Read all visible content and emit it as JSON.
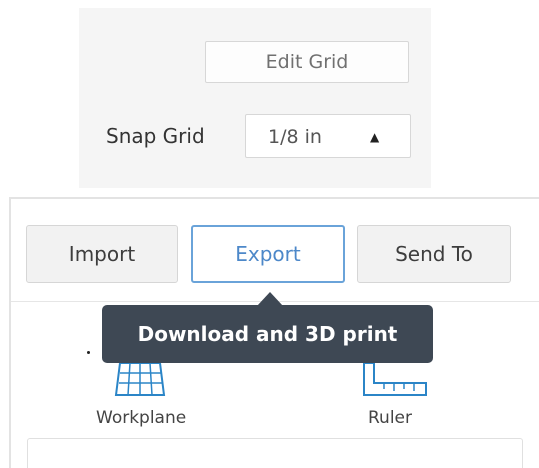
{
  "grid": {
    "edit_label": "Edit Grid",
    "snap_label": "Snap Grid",
    "snap_value": "1/8 in"
  },
  "toolbar": {
    "import_label": "Import",
    "export_label": "Export",
    "send_to_label": "Send To"
  },
  "tooltip": {
    "text": "Download and 3D print"
  },
  "tools": {
    "workplane_label": "Workplane",
    "ruler_label": "Ruler"
  },
  "colors": {
    "accent": "#4d88c9",
    "tooltip_bg": "#3e4854",
    "icon_blue": "#2b85c7"
  }
}
